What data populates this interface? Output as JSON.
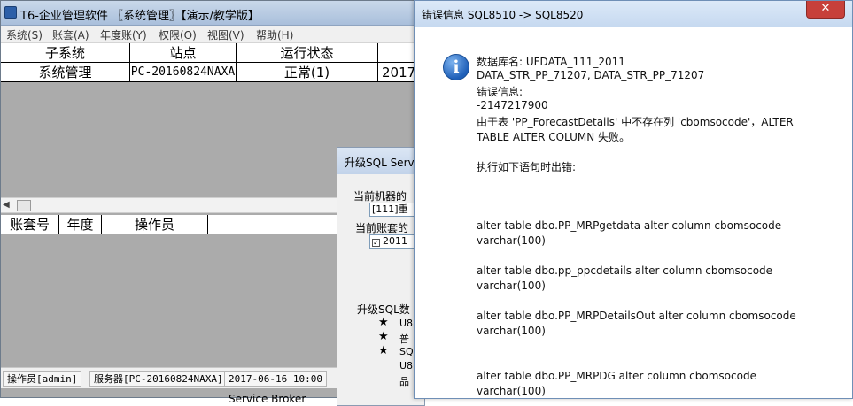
{
  "main_window": {
    "title": "T6-企业管理软件 〖系统管理〗【演示/教学版】",
    "menu": [
      "系统(S)",
      "账套(A)",
      "年度账(Y)",
      "权限(O)",
      "视图(V)",
      "帮助(H)"
    ],
    "grid_top": {
      "headers": [
        "子系统",
        "站点",
        "运行状态",
        ""
      ],
      "row": [
        "系统管理",
        "PC-20160824NAXA",
        "正常(1)",
        "2017"
      ]
    },
    "grid_bottom": {
      "headers": [
        "账套号",
        "年度",
        "操作员"
      ]
    },
    "status_bar": [
      "操作员[admin]",
      "服务器[PC-20160824NAXA]",
      "2017-06-16 10:00"
    ]
  },
  "upgrade_dialog": {
    "title": "升级SQL Serv",
    "label_machine": "当前机器的",
    "machine_value": "[111]重",
    "label_account": "当前账套的",
    "account_value": "2011",
    "label_upgrade": "升级SQL数",
    "items": [
      "U8",
      "普",
      "SQ",
      "U8",
      "品"
    ],
    "service_broker": "Service Broker"
  },
  "error_dialog": {
    "title": "错误信息  SQL8510 -> SQL8520",
    "close_glyph": "✕",
    "icon_glyph": "i",
    "lines": [
      "数据库名: UFDATA_111_2011",
      "DATA_STR_PP_71207, DATA_STR_PP_71207",
      "错误信息:",
      "-2147217900",
      "由于表 'PP_ForecastDetails' 中不存在列 'cbomsocode'，ALTER",
      "TABLE ALTER COLUMN 失败。",
      "",
      "执行如下语句时出错:",
      "",
      "",
      "",
      "alter table dbo.PP_MRPgetdata alter column cbomsocode",
      "varchar(100)",
      "",
      "alter table dbo.pp_ppcdetails alter column cbomsocode",
      "varchar(100)",
      "",
      "alter table dbo.PP_MRPDetailsOut alter column cbomsocode",
      "varchar(100)",
      "",
      "",
      "alter table dbo.PP_MRPDG  alter column cbomsocode",
      "varchar(100)"
    ]
  }
}
